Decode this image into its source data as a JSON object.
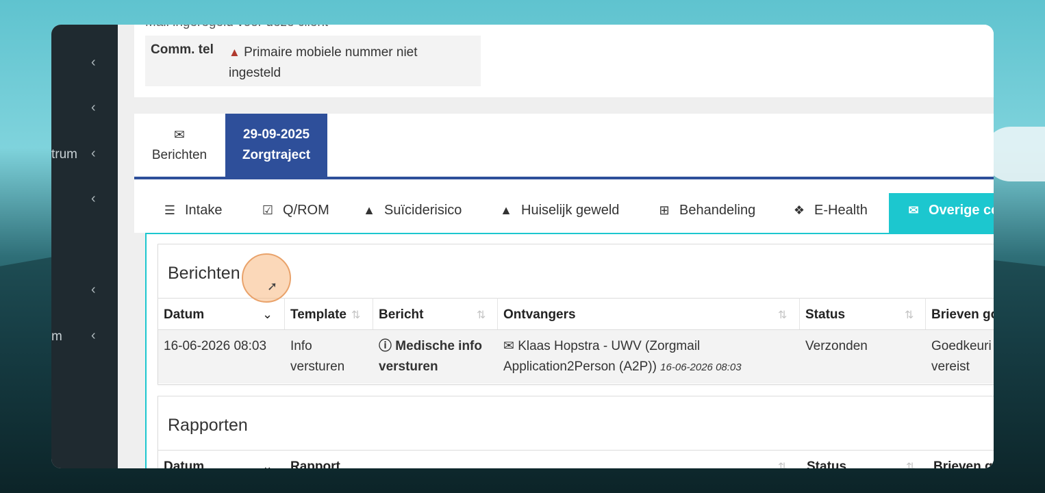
{
  "sidebar": {
    "items": [
      {
        "label": "",
        "chevron": "‹"
      },
      {
        "label": "",
        "chevron": "‹"
      },
      {
        "label": "trum",
        "chevron": "‹"
      },
      {
        "label": "",
        "chevron": "‹"
      },
      {
        "label": "",
        "chevron": "‹"
      },
      {
        "label": "m",
        "chevron": "‹"
      }
    ]
  },
  "top_info": {
    "cut_text": "Mail           ingeregeld voor deze client",
    "key": "Comm. tel",
    "value": "Primaire mobiele nummer niet ingesteld"
  },
  "tabs": {
    "messages": {
      "icon": "envelope-icon",
      "label": "Berichten"
    },
    "active": {
      "line1": "29-09-2025",
      "line2": "Zorgtraject"
    }
  },
  "subtabs": [
    {
      "icon": "sliders-icon",
      "label": "Intake"
    },
    {
      "icon": "check-square-icon",
      "label": "Q/ROM"
    },
    {
      "icon": "warning-icon",
      "label": "Suïciderisico"
    },
    {
      "icon": "warning-icon",
      "label": "Huiselijk geweld"
    },
    {
      "icon": "medkit-icon",
      "label": "Behandeling"
    },
    {
      "icon": "cubes-icon",
      "label": "E-Health"
    },
    {
      "icon": "envelope-icon",
      "label": "Overige co"
    }
  ],
  "berichten": {
    "title": "Berichten",
    "headers": [
      "Datum",
      "Template",
      "Bericht",
      "Ontvangers",
      "Status",
      "Brieven go"
    ],
    "row": {
      "datum": "16-06-2026 08:03",
      "template": "Info versturen",
      "bericht": "Medische info versturen",
      "ontvangers": "Klaas Hopstra - UWV (Zorgmail Application2Person (A2P))",
      "ontvangers_time": "16-06-2026 08:03",
      "status": "Verzonden",
      "brieven": "Goedkeuri vereist"
    }
  },
  "rapporten": {
    "title": "Rapporten",
    "headers": [
      "Datum",
      "Rapport",
      "Status",
      "Brieven g"
    ]
  },
  "colors": {
    "primary": "#2e4f9a",
    "accent": "#1cc7cf",
    "sidebar": "#1f2a30",
    "warning": "#b03a2e"
  }
}
